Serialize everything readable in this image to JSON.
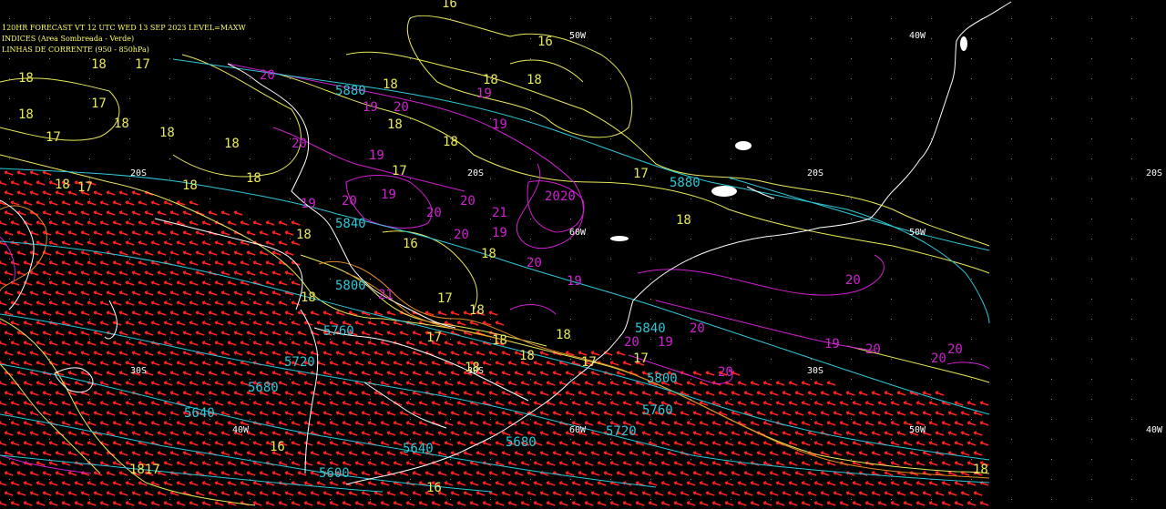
{
  "header": {
    "line1": "120HR FORECAST    VT 12 UTC WED 13 SEP 2023    LEVEL=MAXW",
    "line2": "INDICES (Area Sombreada - Verde)",
    "line3": "LINHAS DE CORRENTE (950 - 850hPa)"
  },
  "colors": {
    "background": "#000000",
    "coastline": "#ffffff",
    "wind_vectors": "#ff2020",
    "height_contours": "#2ec8d8",
    "magenta_contours": "#d020d0",
    "yellow_contours": "#e8e85a",
    "orange_contours": "#e08a20",
    "grid_labels": "#ffffff"
  },
  "grid_labels": {
    "lon": [
      "50W",
      "40W",
      "60W",
      "50W",
      "40W",
      "60W",
      "50W",
      "40W"
    ],
    "lat": [
      "20S",
      "20S",
      "20S",
      "20S",
      "30S",
      "30S",
      "30S"
    ]
  },
  "cyan_labels": [
    "5880",
    "5880",
    "5840",
    "5800",
    "5760",
    "5720",
    "5680",
    "5640",
    "5840",
    "5800",
    "5760",
    "5720",
    "5680",
    "5640",
    "5600"
  ],
  "magenta_labels": [
    "20",
    "19",
    "19",
    "20",
    "20",
    "19",
    "19",
    "19",
    "20",
    "19",
    "20",
    "20",
    "21",
    "20",
    "19",
    "20",
    "20",
    "20",
    "19",
    "21",
    "20",
    "19",
    "20",
    "20",
    "19",
    "20",
    "20",
    "20",
    "20"
  ],
  "yellow_labels": [
    "16",
    "16",
    "18",
    "17",
    "18",
    "18",
    "18",
    "18",
    "17",
    "18",
    "18",
    "18",
    "17",
    "18",
    "18",
    "17",
    "18",
    "18",
    "18",
    "17",
    "17",
    "18",
    "18",
    "16",
    "18",
    "17",
    "18",
    "18",
    "17",
    "18",
    "18",
    "17",
    "17",
    "18",
    "18",
    "18",
    "16",
    "16",
    "1817",
    "18"
  ]
}
